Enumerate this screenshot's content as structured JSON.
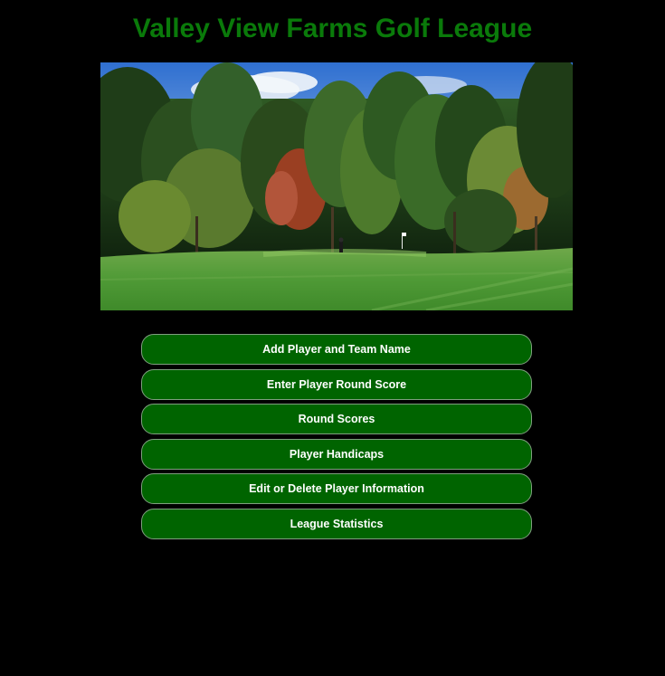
{
  "page": {
    "title": "Valley View Farms Golf League",
    "title_color": "#0a7a0a",
    "background_color": "#000000"
  },
  "hero": {
    "image_name": "golf-course-photo",
    "alt": "Golf course green with trees"
  },
  "menu": {
    "button_color": "#006400",
    "items": [
      {
        "label": "Add Player and Team Name"
      },
      {
        "label": "Enter Player Round Score"
      },
      {
        "label": "Round Scores"
      },
      {
        "label": "Player Handicaps"
      },
      {
        "label": "Edit or Delete Player Information"
      },
      {
        "label": "League Statistics"
      }
    ]
  }
}
